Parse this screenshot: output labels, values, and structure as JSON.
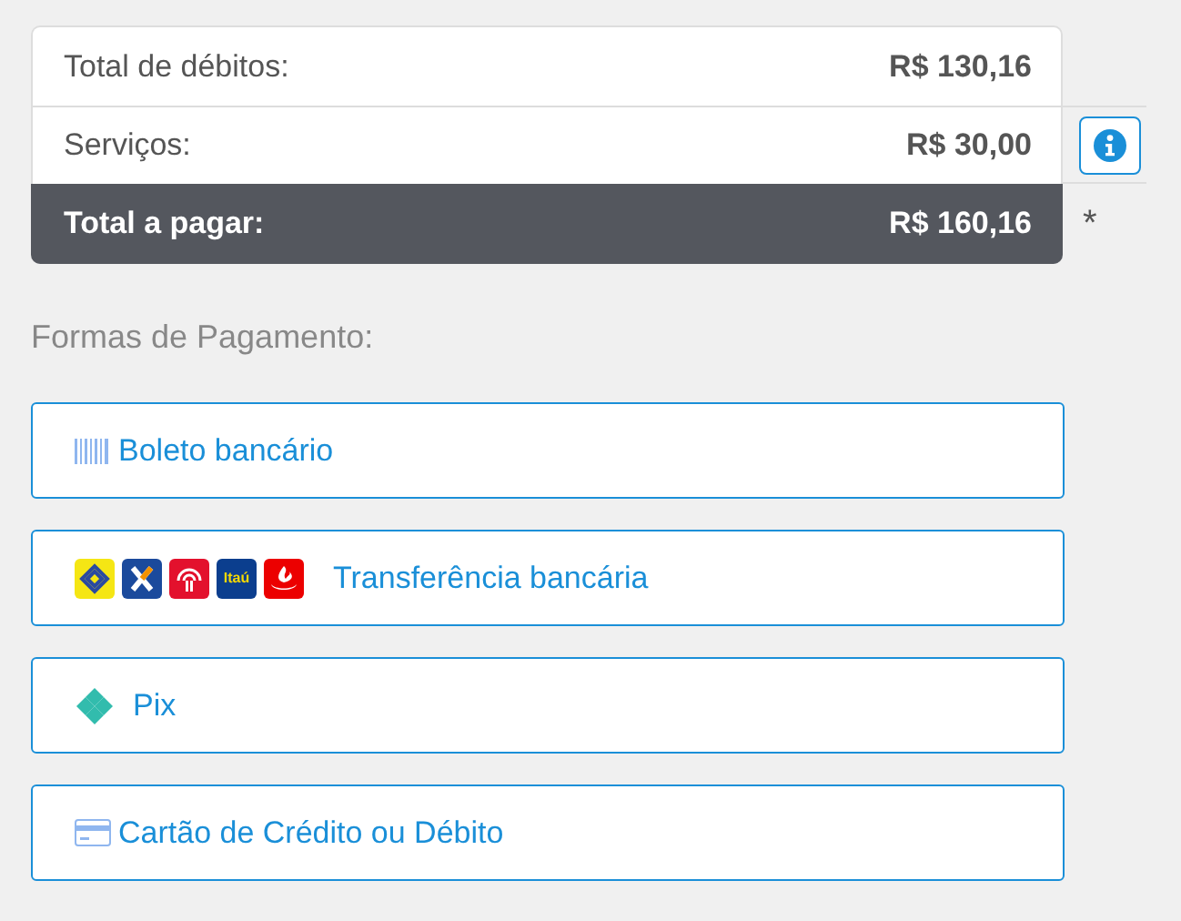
{
  "summary": [
    {
      "kind": "debits",
      "label": "Total de débitos:",
      "value": "R$ 130,16"
    },
    {
      "kind": "services",
      "label": "Serviços:",
      "value": "R$ 30,00"
    },
    {
      "kind": "total",
      "label": "Total a pagar:",
      "value": "R$ 160,16",
      "note": "*"
    }
  ],
  "payment_title": "Formas de Pagamento:",
  "methods": [
    {
      "kind": "boleto",
      "label": "Boleto bancário"
    },
    {
      "kind": "transfer",
      "label": "Transferência bancária",
      "banks": [
        {
          "kind": "bb"
        },
        {
          "kind": "caixa"
        },
        {
          "kind": "bradesco"
        },
        {
          "kind": "itau",
          "label": "Itaú"
        },
        {
          "kind": "santander"
        }
      ]
    },
    {
      "kind": "pix",
      "label": "Pix"
    },
    {
      "kind": "card",
      "label": "Cartão de Crédito ou Débito"
    }
  ]
}
